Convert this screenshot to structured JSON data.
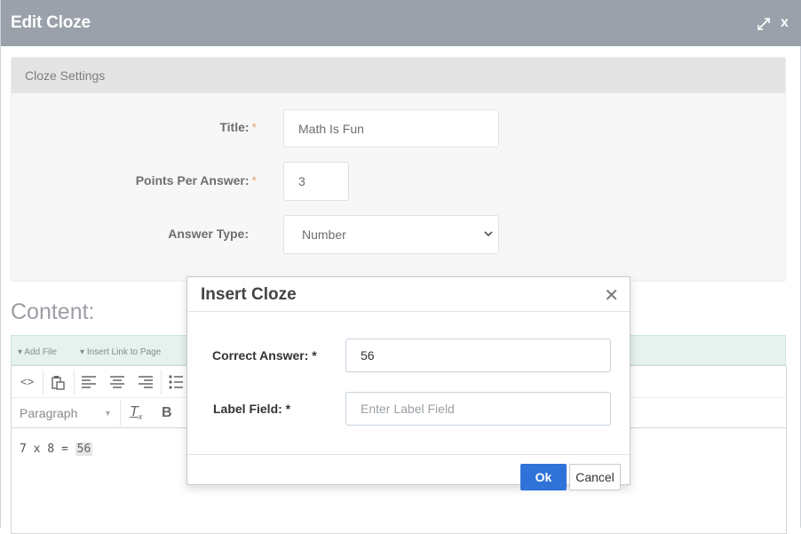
{
  "window": {
    "title": "Edit Cloze",
    "close_label": "x"
  },
  "settings": {
    "header": "Cloze Settings",
    "title_label": "Title:",
    "title_value": "Math Is Fun",
    "points_label": "Points Per Answer:",
    "points_value": "3",
    "answer_type_label": "Answer Type:",
    "answer_type_value": "Number",
    "required_mark": "*"
  },
  "content": {
    "heading": "Content:",
    "file_bar": {
      "add_file": "Add File",
      "insert_link": "Insert Link to Page"
    },
    "toolbar": {
      "paragraph": "Paragraph",
      "bold": "B"
    },
    "editor_text": "7 x 8 = ",
    "cloze_value": "56"
  },
  "modal": {
    "title": "Insert Cloze",
    "close_glyph": "✕",
    "correct_answer_label": "Correct Answer: *",
    "correct_answer_value": "56",
    "label_field_label": "Label Field: *",
    "label_field_placeholder": "Enter Label Field",
    "ok_label": "Ok",
    "cancel_label": "Cancel"
  }
}
